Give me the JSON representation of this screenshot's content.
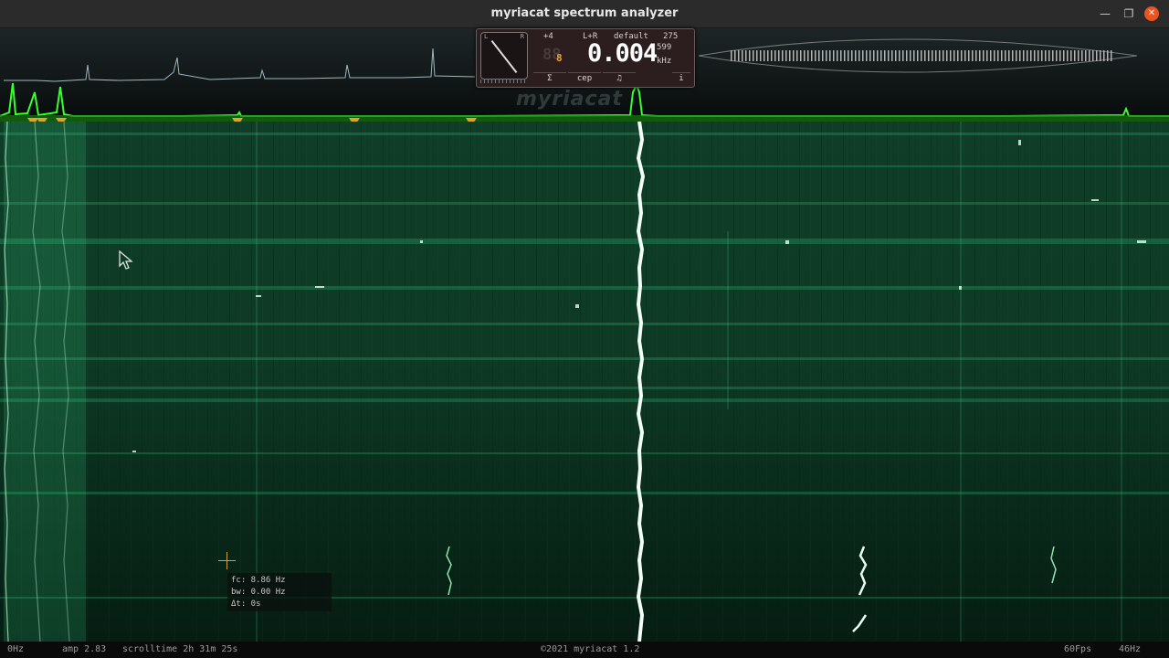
{
  "window": {
    "title": "myriacat spectrum analyzer",
    "minimize_icon": "minimize-icon",
    "maximize_icon": "restore-icon",
    "close_icon": "close-icon"
  },
  "meter": {
    "dial_left": "L",
    "dial_right": "R",
    "offset": "+4",
    "channel": "L+R",
    "preset": "default",
    "count": "275",
    "octave_small": "8",
    "frequency": "0.004",
    "aux_value": "599",
    "unit": "kHz",
    "buttons": {
      "sigma": "Σ",
      "cep": "cep",
      "music": "♫",
      "info": "i"
    }
  },
  "watermark": "myriacat",
  "readout": {
    "fc": "fc: 8.86 Hz",
    "bw": "bw: 0.00 Hz",
    "dt": "Δt: 0s"
  },
  "statusbar": {
    "left_freq": "0Hz",
    "amp": "amp 2.83",
    "scrolltime": "scrolltime 2h 31m 25s",
    "copyright": "©2021 myriacat 1.2",
    "fps": "60Fps",
    "right_freq": "46Hz"
  },
  "colors": {
    "spectrum": "#39ff2e",
    "markers": "#d9a625",
    "spectrogram_bg": "#0e3a25",
    "close_button": "#e95420"
  }
}
